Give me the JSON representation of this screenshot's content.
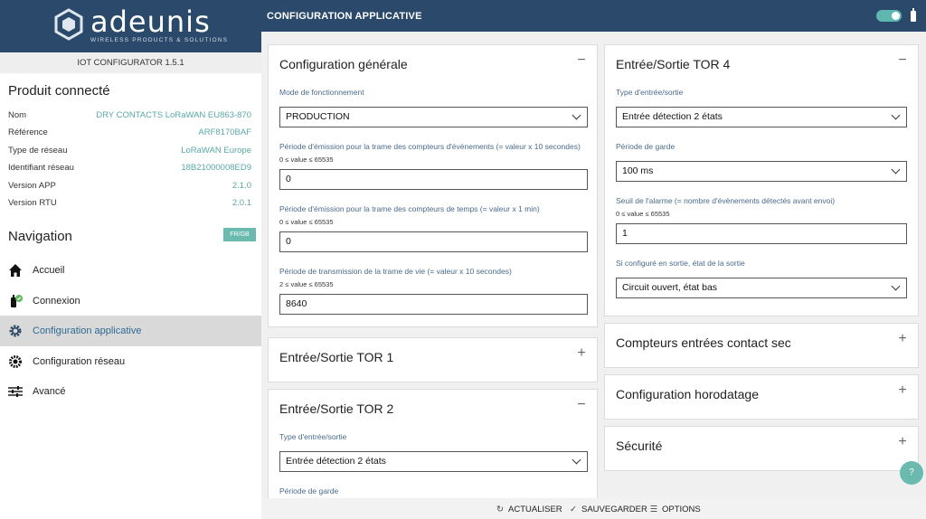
{
  "app": {
    "brand": "adeunis",
    "tagline": "WIRELESS PRODUCTS & SOLUTIONS",
    "page_title": "CONFIGURATION APPLICATIVE",
    "version": "IOT CONFIGURATOR 1.5.1",
    "accent": "#6bbab0",
    "header_color": "#2b4a6b"
  },
  "product": {
    "title": "Produit connecté",
    "props": [
      {
        "key": "Nom",
        "value": "DRY CONTACTS LoRaWAN EU863-870"
      },
      {
        "key": "Référence",
        "value": "ARF8170BAF"
      },
      {
        "key": "Type de réseau",
        "value": "LoRaWAN Europe"
      },
      {
        "key": "Identifiant réseau",
        "value": "18B21000008ED9"
      },
      {
        "key": "Version APP",
        "value": "2.1.0"
      },
      {
        "key": "Version RTU",
        "value": "2.0.1"
      }
    ]
  },
  "navigation": {
    "title": "Navigation",
    "lang_button": "FR/GB",
    "items": [
      {
        "label": "Accueil",
        "icon": "home-icon"
      },
      {
        "label": "Connexion",
        "icon": "device-connected-icon"
      },
      {
        "label": "Configuration applicative",
        "icon": "gear-icon",
        "active": true
      },
      {
        "label": "Configuration réseau",
        "icon": "network-gear-icon"
      },
      {
        "label": "Avancé",
        "icon": "sliders-icon"
      }
    ]
  },
  "general": {
    "title": "Configuration générale",
    "mode_label": "Mode de fonctionnement",
    "mode_value": "PRODUCTION",
    "p1_label": "Période d'émission pour la trame des compteurs d'événements (= valeur x 10 secondes)",
    "p1_range": "0 ≤ value ≤ 65535",
    "p1_value": "0",
    "p2_label": "Période d'émission pour la trame des compteurs de temps (= valeur x 1 min)",
    "p2_range": "0 ≤ value ≤ 65535",
    "p2_value": "0",
    "p3_label": "Période de transmission de la trame de vie (= valeur x 10 secondes)",
    "p3_range": "2 ≤ value ≤ 65535",
    "p3_value": "8640"
  },
  "tor1": {
    "title": "Entrée/Sortie TOR 1"
  },
  "tor2": {
    "title": "Entrée/Sortie TOR 2",
    "type_label": "Type d'entrée/sortie",
    "type_value": "Entrée détection 2 états",
    "guard_label": "Période de garde"
  },
  "tor4": {
    "title": "Entrée/Sortie TOR 4",
    "type_label": "Type d'entrée/sortie",
    "type_value": "Entrée détection 2 états",
    "guard_label": "Période de garde",
    "guard_value": "100 ms",
    "alarm_label": "Seuil de l'alarme (= nombre d'évènements détectés avant envoi)",
    "alarm_range": "0 ≤ value ≤ 65535",
    "alarm_value": "1",
    "out_label": "Si configuré en sortie, état de la sortie",
    "out_value": "Circuit ouvert, état bas"
  },
  "counters": {
    "title": "Compteurs entrées contact sec"
  },
  "timestamp": {
    "title": "Configuration horodatage"
  },
  "security": {
    "title": "Sécurité"
  },
  "toolbar": {
    "refresh": "ACTUALISER",
    "save": "SAUVEGARDER",
    "options": "OPTIONS"
  },
  "help": {
    "label": "?"
  }
}
